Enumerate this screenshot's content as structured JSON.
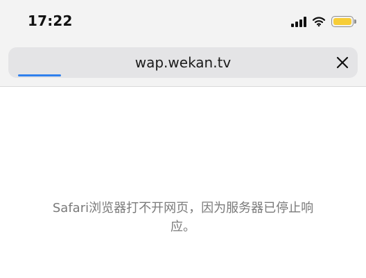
{
  "status_bar": {
    "time": "17:22",
    "icons": [
      "signal-icon",
      "wifi-icon",
      "battery-icon"
    ],
    "battery_color": "#f7cd37"
  },
  "browser": {
    "url": "wap.wekan.tv",
    "close_icon": "close-icon",
    "progress_percent": 13,
    "progress_color": "#2f80ed"
  },
  "error": {
    "message": "Safari浏览器打不开网页，因为服务器已停止响应。"
  }
}
